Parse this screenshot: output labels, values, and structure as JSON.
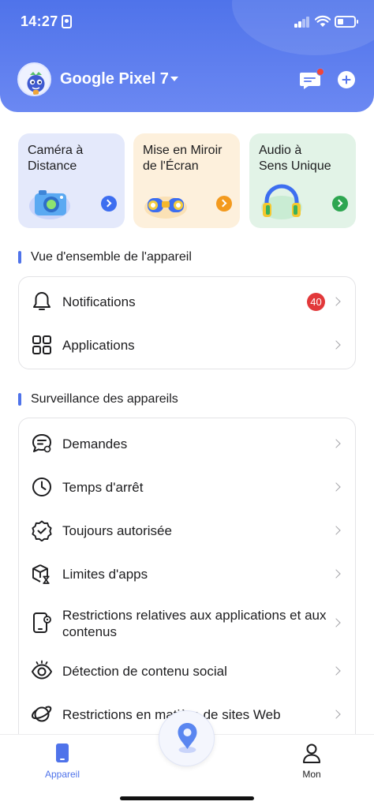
{
  "status_bar": {
    "time": "14:27"
  },
  "header": {
    "device_name": "Google Pixel 7"
  },
  "feature_cards": [
    {
      "title": "Caméra à\nDistance",
      "icon": "camera-icon",
      "accent": "#3d6ef0"
    },
    {
      "title": "Mise en Miroir\nde l'Écran",
      "icon": "binoculars-icon",
      "accent": "#f39a1e"
    },
    {
      "title": "Audio à\nSens Unique",
      "icon": "headphones-icon",
      "accent": "#2ea651"
    }
  ],
  "overview": {
    "title": "Vue d'ensemble de l'appareil",
    "items": [
      {
        "label": "Notifications",
        "icon": "bell-icon",
        "badge": "40"
      },
      {
        "label": "Applications",
        "icon": "apps-grid-icon"
      }
    ]
  },
  "monitoring": {
    "title": "Surveillance des appareils",
    "items": [
      {
        "label": "Demandes",
        "icon": "request-chat-icon"
      },
      {
        "label": "Temps d'arrêt",
        "icon": "clock-icon"
      },
      {
        "label": "Toujours autorisée",
        "icon": "check-badge-icon"
      },
      {
        "label": "Limites d'apps",
        "icon": "app-limit-icon"
      },
      {
        "label": "Restrictions relatives aux applications et aux contenus",
        "icon": "device-settings-icon"
      },
      {
        "label": "Détection de contenu social",
        "icon": "eye-icon"
      },
      {
        "label": "Restrictions en matière de sites Web",
        "icon": "planet-icon"
      }
    ]
  },
  "tabbar": {
    "device_label": "Appareil",
    "me_label": "Mon"
  },
  "colors": {
    "brand": "#4f73ea",
    "badge": "#e2383a"
  }
}
